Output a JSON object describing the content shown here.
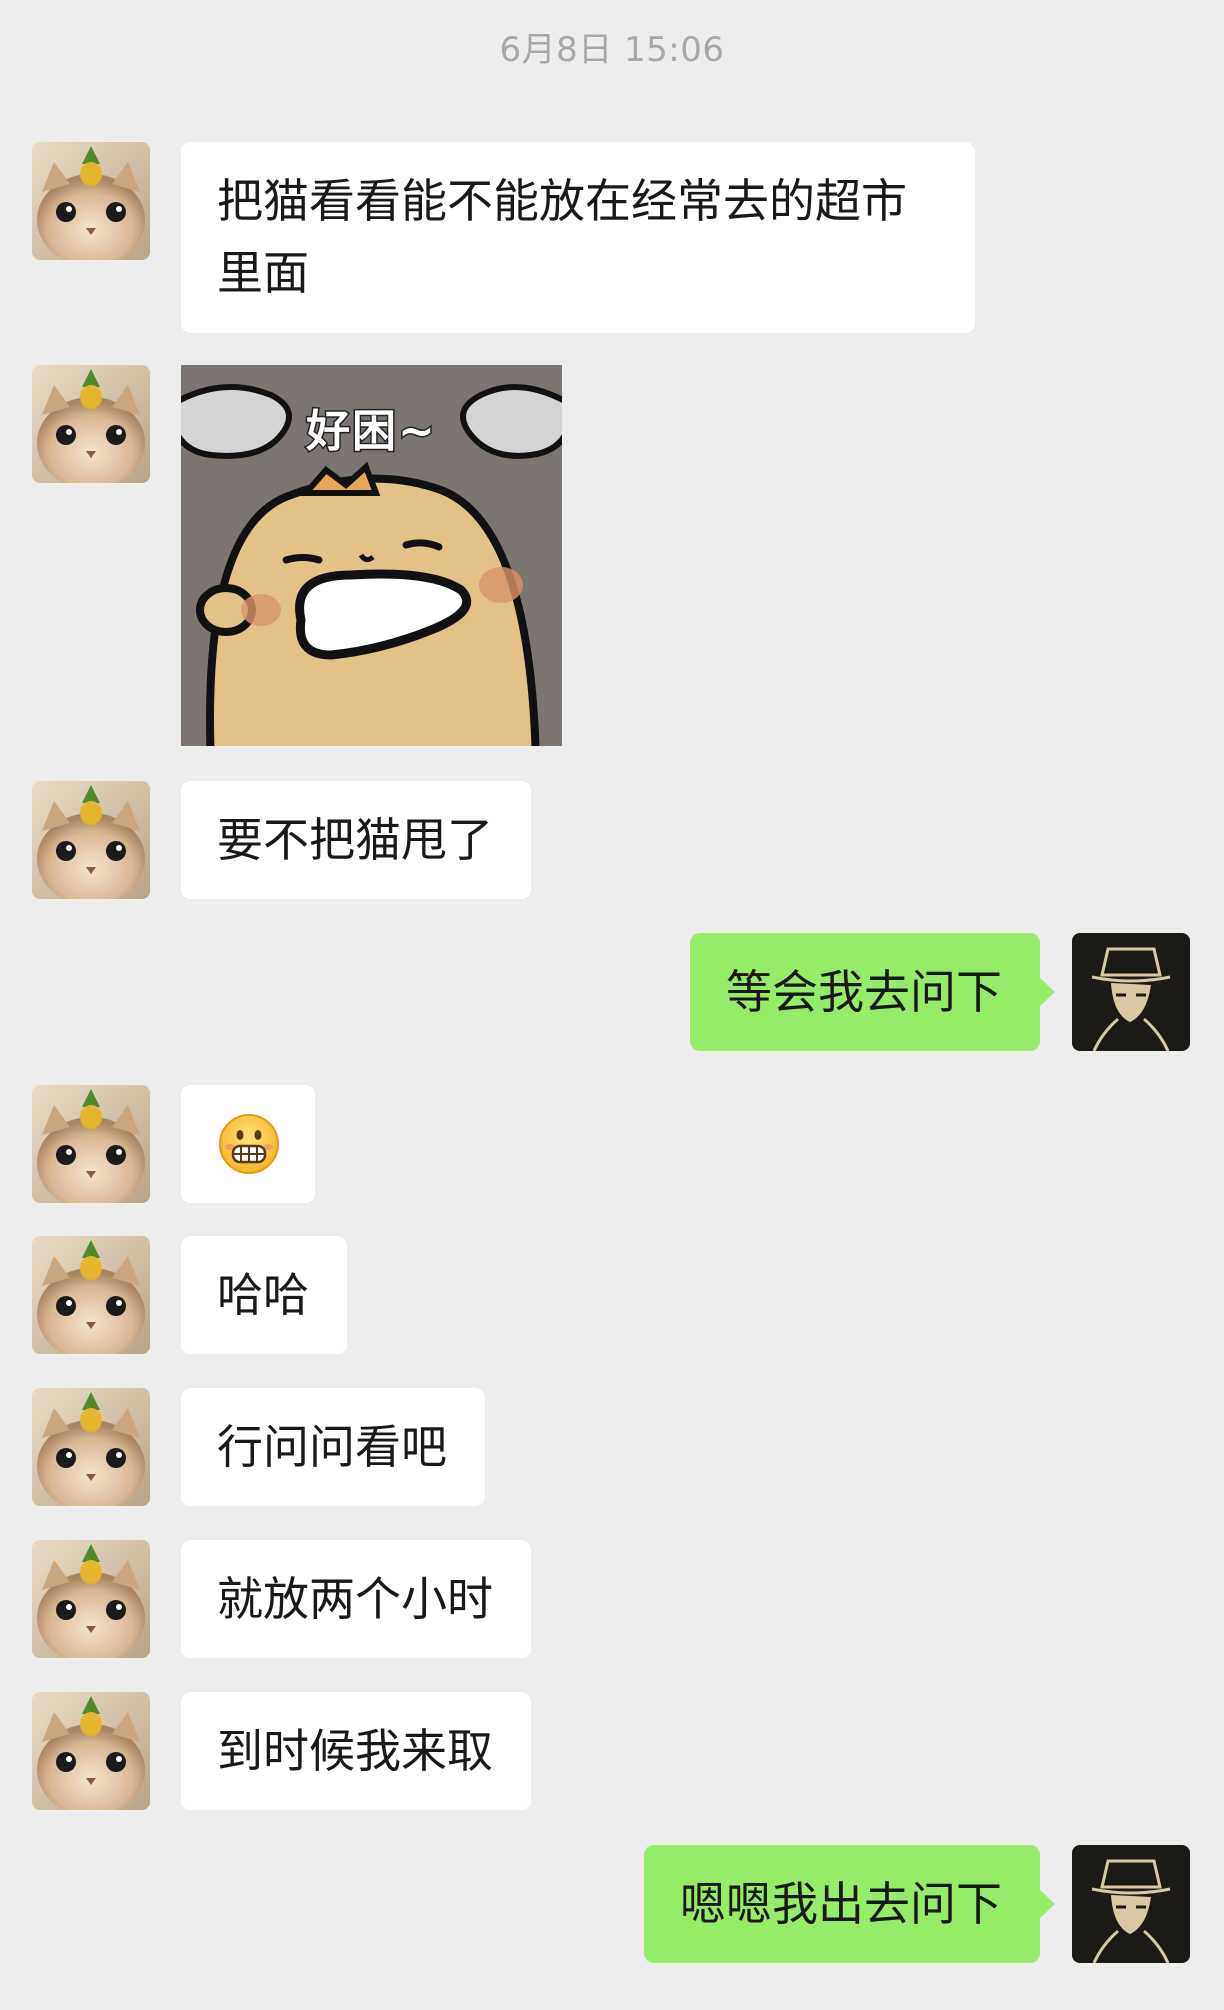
{
  "timestamp": "6月8日 15:06",
  "colors": {
    "background": "#ededed",
    "incoming_bubble": "#ffffff",
    "outgoing_bubble": "#95ec69",
    "timestamp_text": "#a7a7a7"
  },
  "contact_avatar_icon": "cat-with-pineapple-avatar",
  "self_avatar_icon": "man-in-top-hat-avatar",
  "messages": [
    {
      "side": "left",
      "type": "text",
      "text": "把猫看看能不能放在经常去的超市里面"
    },
    {
      "side": "left",
      "type": "sticker",
      "caption": "好困~",
      "icon": "sleepy-bear-sticker"
    },
    {
      "side": "left",
      "type": "text",
      "text": "要不把猫甩了"
    },
    {
      "side": "right",
      "type": "text",
      "text": "等会我去问下"
    },
    {
      "side": "left",
      "type": "emoji",
      "icon": "grinning-emoji"
    },
    {
      "side": "left",
      "type": "text",
      "text": "哈哈"
    },
    {
      "side": "left",
      "type": "text",
      "text": "行问问看吧"
    },
    {
      "side": "left",
      "type": "text",
      "text": "就放两个小时"
    },
    {
      "side": "left",
      "type": "text",
      "text": "到时候我来取"
    },
    {
      "side": "right",
      "type": "text",
      "text": "嗯嗯我出去问下"
    }
  ]
}
